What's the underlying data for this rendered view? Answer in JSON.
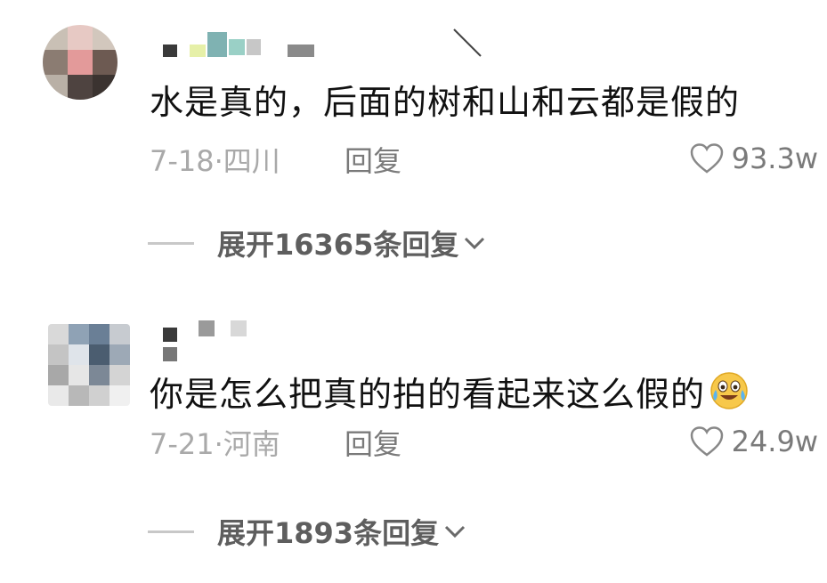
{
  "comments": [
    {
      "text": "水是真的，后面的树和山和云都是假的",
      "meta": "7-18·四川",
      "reply_label": "回复",
      "likes": "93.3w",
      "expand_label": "展开16365条回复"
    },
    {
      "text": "你是怎么把真的拍的看起来这么假的",
      "emoji": "laughing-crying-emoji",
      "meta": "7-21·河南",
      "reply_label": "回复",
      "likes": "24.9w",
      "expand_label": "展开1893条回复"
    }
  ]
}
